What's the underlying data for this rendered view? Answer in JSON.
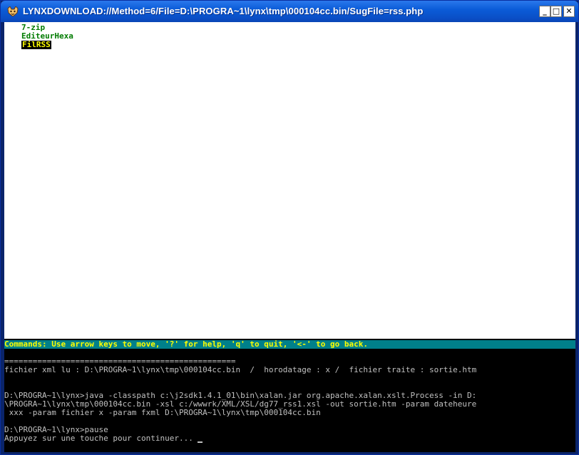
{
  "window": {
    "title": "LYNXDOWNLOAD://Method=6/File=D:\\PROGRA~1\\lynx\\tmp\\000104cc.bin/SugFile=rss.php",
    "buttons": {
      "minimize": "_",
      "maximize": "□",
      "close": "✕"
    }
  },
  "page": {
    "links": [
      {
        "label": "7-zip"
      },
      {
        "label": "EditeurHexa"
      },
      {
        "label": "FilRSS",
        "selected": true
      }
    ]
  },
  "statusbar": {
    "text": "Commands: Use arrow keys to move, '?' for help, 'q' to quit, '<-' to go back."
  },
  "console": {
    "lines": [
      "",
      "=================================================",
      "fichier xml lu : D:\\PROGRA~1\\lynx\\tmp\\000104cc.bin  /  horodatage : x /  fichier traite : sortie.htm",
      "",
      "",
      "D:\\PROGRA~1\\lynx>java -classpath c:\\j2sdk1.4.1_01\\bin\\xalan.jar org.apache.xalan.xslt.Process -in D:",
      "\\PROGRA~1\\lynx\\tmp\\000104cc.bin -xsl c:/wwwrk/XML/XSL/dg77_rss1.xsl -out sortie.htm -param dateheure",
      " xxx -param fichier x -param fxml D:\\PROGRA~1\\lynx\\tmp\\000104cc.bin",
      "",
      "D:\\PROGRA~1\\lynx>pause",
      "Appuyez sur une touche pour continuer..."
    ]
  },
  "colors": {
    "titlebar": "#0b5cd8",
    "link": "#007b00",
    "selected_link_bg": "#000000",
    "selected_link_fg": "#ffff00",
    "statusbar_bg": "#00808a",
    "statusbar_fg": "#ffff00",
    "console_fg": "#c0c0c0"
  },
  "icons": {
    "app": "lynx-icon",
    "minimize": "minimize-icon",
    "maximize": "maximize-icon",
    "close": "close-icon"
  }
}
